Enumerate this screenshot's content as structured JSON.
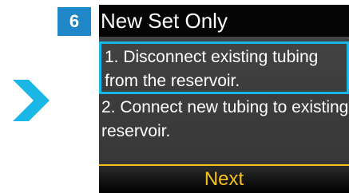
{
  "step": {
    "number": "6",
    "badge_color": "#1f86c7"
  },
  "nav": {
    "arrow_icon": "chevron-right-icon",
    "arrow_color": "#19b6e6"
  },
  "screen": {
    "title": "New Set Only",
    "steps": [
      {
        "text": "1. Disconnect existing tubing from the reservoir.",
        "selected": true
      },
      {
        "text": "2. Connect new tubing to existing reservoir.",
        "selected": false
      }
    ],
    "selection_color": "#19b6e6",
    "next_label": "Next",
    "next_color": "#f7c21b"
  }
}
